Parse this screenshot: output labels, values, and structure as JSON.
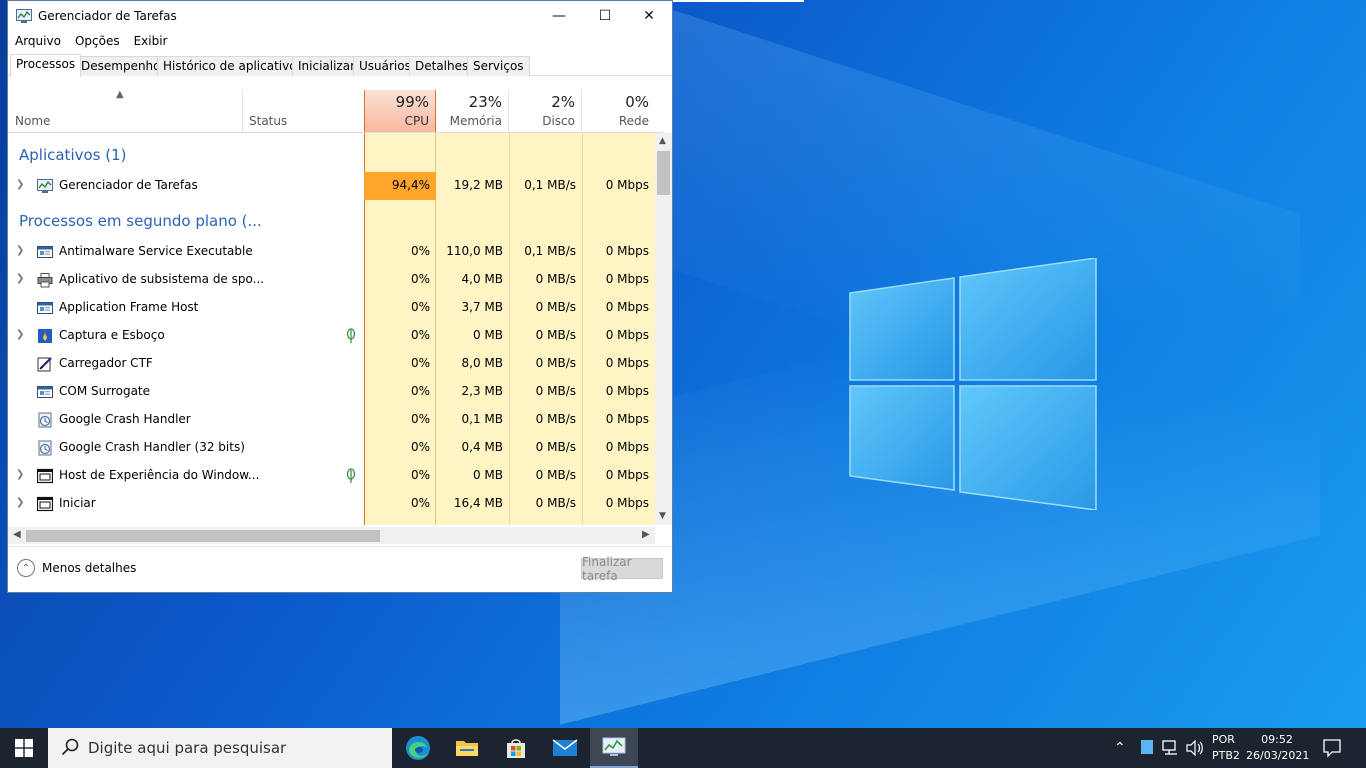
{
  "window": {
    "title": "Gerenciador de Tarefas",
    "min_glyph": "—",
    "max_glyph": "☐",
    "close_glyph": "✕"
  },
  "menu": [
    "Arquivo",
    "Opções",
    "Exibir"
  ],
  "tabs": [
    "Processos",
    "Desempenho",
    "Histórico de aplicativos",
    "Inicializar",
    "Usuários",
    "Detalhes",
    "Serviços"
  ],
  "columns": {
    "name": "Nome",
    "status": "Status",
    "cpu": {
      "pct": "99%",
      "label": "CPU"
    },
    "memory": {
      "pct": "23%",
      "label": "Memória"
    },
    "disk": {
      "pct": "2%",
      "label": "Disco"
    },
    "network": {
      "pct": "0%",
      "label": "Rede"
    }
  },
  "groups": {
    "apps": "Aplicativos (1)",
    "background": "Processos em segundo plano (..."
  },
  "apps": [
    {
      "name": "Gerenciador de Tarefas",
      "icon": "task-manager-icon",
      "cpu": "94,4%",
      "mem": "19,2 MB",
      "disk": "0,1 MB/s",
      "net": "0 Mbps"
    }
  ],
  "background": [
    {
      "name": "Antimalware Service Executable",
      "icon": "service-window-icon",
      "cpu": "0%",
      "mem": "110,0 MB",
      "disk": "0,1 MB/s",
      "net": "0 Mbps"
    },
    {
      "name": "Aplicativo de subsistema de spo...",
      "icon": "printer-icon",
      "cpu": "0%",
      "mem": "4,0 MB",
      "disk": "0 MB/s",
      "net": "0 Mbps"
    },
    {
      "name": "Application Frame Host",
      "icon": "service-window-icon",
      "cpu": "0%",
      "mem": "3,7 MB",
      "disk": "0 MB/s",
      "net": "0 Mbps"
    },
    {
      "name": "Captura e Esboço",
      "icon": "snip-sketch-icon",
      "cpu": "0%",
      "mem": "0 MB",
      "disk": "0 MB/s",
      "net": "0 Mbps"
    },
    {
      "name": "Carregador CTF",
      "icon": "pen-icon",
      "cpu": "0%",
      "mem": "8,0 MB",
      "disk": "0 MB/s",
      "net": "0 Mbps"
    },
    {
      "name": "COM Surrogate",
      "icon": "service-window-icon",
      "cpu": "0%",
      "mem": "2,3 MB",
      "disk": "0 MB/s",
      "net": "0 Mbps"
    },
    {
      "name": "Google Crash Handler",
      "icon": "google-crash-icon",
      "cpu": "0%",
      "mem": "0,1 MB",
      "disk": "0 MB/s",
      "net": "0 Mbps"
    },
    {
      "name": "Google Crash Handler (32 bits)",
      "icon": "google-crash-icon",
      "cpu": "0%",
      "mem": "0,4 MB",
      "disk": "0 MB/s",
      "net": "0 Mbps"
    },
    {
      "name": "Host de Experiência do Window...",
      "icon": "window-host-icon",
      "cpu": "0%",
      "mem": "0 MB",
      "disk": "0 MB/s",
      "net": "0 Mbps"
    },
    {
      "name": "Iniciar",
      "icon": "window-host-icon",
      "cpu": "0%",
      "mem": "16,4 MB",
      "disk": "0 MB/s",
      "net": "0 Mbps"
    }
  ],
  "footer": {
    "less_details": "Menos detalhes",
    "end_task": "Finalizar tarefa"
  },
  "taskbar": {
    "search_placeholder": "Digite aqui para pesquisar",
    "lang_line1": "POR",
    "lang_line2": "PTB2",
    "time": "09:52",
    "date": "26/03/2021"
  },
  "colors": {
    "cpu_hot": "#ffa52c",
    "column_heat": "#fff4c4",
    "group_title": "#2a63b4",
    "taskbar": "#1c2430"
  }
}
